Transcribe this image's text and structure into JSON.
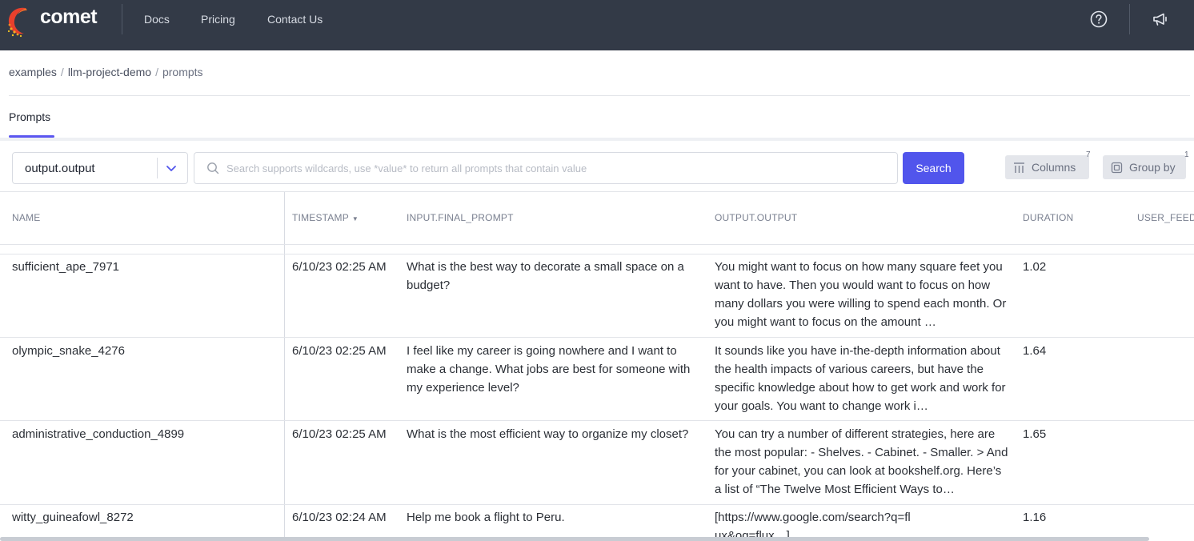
{
  "navbar": {
    "brand": "comet",
    "links": [
      "Docs",
      "Pricing",
      "Contact Us"
    ],
    "icons": [
      "help-icon",
      "announcement-icon"
    ]
  },
  "breadcrumb": {
    "workspace": "examples",
    "project": "llm-project-demo",
    "page": "prompts"
  },
  "tabs": {
    "active": "Prompts"
  },
  "toolbar": {
    "field_select": "output.output",
    "search_placeholder": "Search supports wildcards, use *value* to return all prompts that contain value",
    "search_button": "Search",
    "columns_label": "Columns",
    "columns_count": "7",
    "group_by_label": "Group by",
    "group_by_count": "1"
  },
  "table": {
    "headers": {
      "name": "NAME",
      "timestamp": "TIMESTAMP",
      "input": "INPUT.FINAL_PROMPT",
      "output": "OUTPUT.OUTPUT",
      "duration": "DURATION",
      "user_feedback": "USER_FEED"
    },
    "rows": [
      {
        "name": "sufficient_ape_7971",
        "timestamp": "6/10/23 02:25 AM",
        "input": "What is the best way to decorate a small space on a budget?",
        "output": "You might want to focus on how many square feet you want to have. Then you would want to focus on how many dollars you were willing to spend each month. Or you might want to focus on the amount …",
        "duration": "1.02"
      },
      {
        "name": "olympic_snake_4276",
        "timestamp": "6/10/23 02:25 AM",
        "input": "I feel like my career is going nowhere and I want to make a change. What jobs are best for someone with my experience level?",
        "output": "It sounds like you have in-the-depth information about the health impacts of various careers, but have the specific knowledge about how to get work and work for your goals. You want to change work i…",
        "duration": "1.64"
      },
      {
        "name": "administrative_conduction_4899",
        "timestamp": "6/10/23 02:25 AM",
        "input": "What is the most efficient way to organize my closet?",
        "output": "You can try a number of different strategies, here are the most popular: - Shelves. - Cabinet. - Smaller. > And for your cabinet, you can look at bookshelf.org. Here’s a list of “The Twelve Most Efficient Ways to…",
        "duration": "1.65"
      },
      {
        "name": "witty_guineafowl_8272",
        "timestamp": "6/10/23 02:24 AM",
        "input": "Help me book a flight to Peru.",
        "output": "[https://www.google.com/search?q=flux&oq=flux…]",
        "duration": "1.16"
      }
    ]
  },
  "colors": {
    "navbar_bg": "#333a47",
    "accent": "#5155ec",
    "text": "#2b2f36"
  }
}
